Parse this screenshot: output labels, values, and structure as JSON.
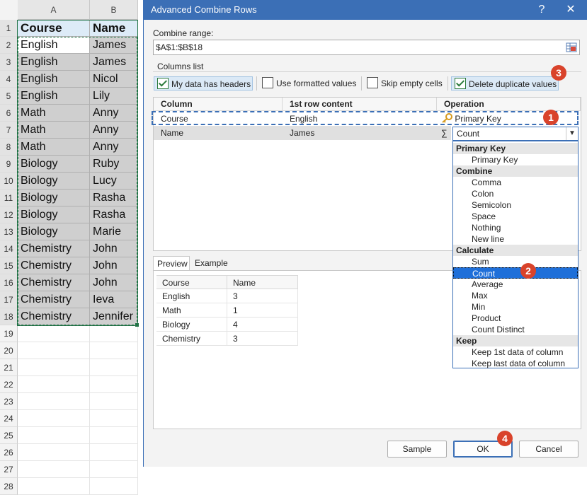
{
  "sheet": {
    "col_headers": [
      "A",
      "B"
    ],
    "rows": [
      {
        "n": "1",
        "a": "Course",
        "b": "Name"
      },
      {
        "n": "2",
        "a": "English",
        "b": "James"
      },
      {
        "n": "3",
        "a": "English",
        "b": "James"
      },
      {
        "n": "4",
        "a": "English",
        "b": "Nicol"
      },
      {
        "n": "5",
        "a": "English",
        "b": "Lily"
      },
      {
        "n": "6",
        "a": "Math",
        "b": "Anny"
      },
      {
        "n": "7",
        "a": "Math",
        "b": "Anny"
      },
      {
        "n": "8",
        "a": "Math",
        "b": "Anny"
      },
      {
        "n": "9",
        "a": "Biology",
        "b": "Ruby"
      },
      {
        "n": "10",
        "a": "Biology",
        "b": "Lucy"
      },
      {
        "n": "11",
        "a": "Biology",
        "b": "Rasha"
      },
      {
        "n": "12",
        "a": "Biology",
        "b": "Rasha"
      },
      {
        "n": "13",
        "a": "Biology",
        "b": "Marie"
      },
      {
        "n": "14",
        "a": "Chemistry",
        "b": "John"
      },
      {
        "n": "15",
        "a": "Chemistry",
        "b": "John"
      },
      {
        "n": "16",
        "a": "Chemistry",
        "b": "John"
      },
      {
        "n": "17",
        "a": "Chemistry",
        "b": "Ieva"
      },
      {
        "n": "18",
        "a": "Chemistry",
        "b": "Jennifer"
      },
      {
        "n": "19",
        "a": "",
        "b": ""
      },
      {
        "n": "20",
        "a": "",
        "b": ""
      },
      {
        "n": "21",
        "a": "",
        "b": ""
      },
      {
        "n": "22",
        "a": "",
        "b": ""
      },
      {
        "n": "23",
        "a": "",
        "b": ""
      },
      {
        "n": "24",
        "a": "",
        "b": ""
      },
      {
        "n": "25",
        "a": "",
        "b": ""
      },
      {
        "n": "26",
        "a": "",
        "b": ""
      },
      {
        "n": "27",
        "a": "",
        "b": ""
      },
      {
        "n": "28",
        "a": "",
        "b": ""
      }
    ]
  },
  "dialog": {
    "title": "Advanced Combine Rows",
    "help": "?",
    "close": "✕",
    "combine_range_label": "Combine range:",
    "combine_range_value": "$A$1:$B$18",
    "columns_list_label": "Columns list",
    "options": {
      "headers": "My data has headers",
      "formatted": "Use formatted values",
      "skip_empty": "Skip empty cells",
      "delete_dup": "Delete duplicate values"
    },
    "grid_headers": [
      "Column",
      "1st row content",
      "Operation"
    ],
    "grid_rows": [
      {
        "column": "Course",
        "first": "English",
        "operation": "Primary Key"
      },
      {
        "column": "Name",
        "first": "James",
        "operation": "Count"
      }
    ],
    "sigma": "∑",
    "dropdown": [
      {
        "kind": "grp",
        "label": "Primary Key"
      },
      {
        "kind": "opt",
        "label": "Primary Key"
      },
      {
        "kind": "grp",
        "label": "Combine"
      },
      {
        "kind": "opt",
        "label": "Comma"
      },
      {
        "kind": "opt",
        "label": "Colon"
      },
      {
        "kind": "opt",
        "label": "Semicolon"
      },
      {
        "kind": "opt",
        "label": "Space"
      },
      {
        "kind": "opt",
        "label": "Nothing"
      },
      {
        "kind": "opt",
        "label": "New line"
      },
      {
        "kind": "grp",
        "label": "Calculate"
      },
      {
        "kind": "opt",
        "label": "Sum"
      },
      {
        "kind": "opt",
        "label": "Count",
        "selected": true
      },
      {
        "kind": "opt",
        "label": "Average"
      },
      {
        "kind": "opt",
        "label": "Max"
      },
      {
        "kind": "opt",
        "label": "Min"
      },
      {
        "kind": "opt",
        "label": "Product"
      },
      {
        "kind": "opt",
        "label": "Count Distinct"
      },
      {
        "kind": "grp",
        "label": "Keep"
      },
      {
        "kind": "opt",
        "label": "Keep 1st data of column"
      },
      {
        "kind": "opt",
        "label": "Keep last data of column"
      }
    ],
    "tabs": [
      "Preview",
      "Example"
    ],
    "preview_headers": [
      "Course",
      "Name"
    ],
    "preview_rows": [
      [
        "English",
        "3"
      ],
      [
        "Math",
        "1"
      ],
      [
        "Biology",
        "4"
      ],
      [
        "Chemistry",
        "3"
      ]
    ],
    "buttons": {
      "sample": "Sample",
      "ok": "OK",
      "cancel": "Cancel"
    },
    "badges": [
      "1",
      "2",
      "3",
      "4"
    ]
  },
  "colors": {
    "title_bar": "#3b6fb6",
    "selection": "#1e6fd9",
    "badge": "#d9432b",
    "sheet_header": "#ddebf7"
  }
}
